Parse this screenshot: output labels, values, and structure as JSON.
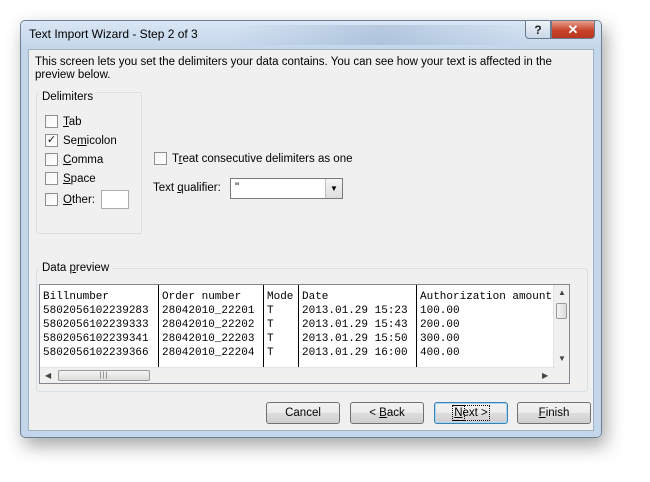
{
  "window": {
    "title": "Text Import Wizard - Step 2 of 3",
    "help_glyph": "?",
    "close_glyph": "✕"
  },
  "intro": "This screen lets you set the delimiters your data contains.  You can see how your text is affected in the preview below.",
  "delimiters": {
    "label": "Delimiters",
    "options": [
      {
        "label": "Tab",
        "checked": false,
        "mark": ""
      },
      {
        "label": "Semicolon",
        "checked": true,
        "mark": "✓"
      },
      {
        "label": "Comma",
        "checked": false,
        "mark": ""
      },
      {
        "label": "Space",
        "checked": false,
        "mark": ""
      },
      {
        "label": "Other:",
        "checked": false,
        "mark": ""
      }
    ],
    "other_value": ""
  },
  "treat_consecutive": {
    "label": "Treat consecutive delimiters as one",
    "checked": false
  },
  "text_qualifier": {
    "label": "Text qualifier:",
    "value": "\""
  },
  "data_preview": {
    "label": "Data preview",
    "columns": [
      "Billnumber",
      "Order number",
      "Mode",
      "Date",
      "Authorization amount"
    ],
    "rows": [
      [
        "5802056102239283",
        "28042010_22201",
        "T",
        "2013.01.29 15:23",
        "100.00"
      ],
      [
        "5802056102239333",
        "28042010_22202",
        "T",
        "2013.01.29 15:43",
        "200.00"
      ],
      [
        "5802056102239341",
        "28042010_22203",
        "T",
        "2013.01.29 15:50",
        "300.00"
      ],
      [
        "5802056102239366",
        "28042010_22204",
        "T",
        "2013.01.29 16:00",
        "400.00"
      ]
    ]
  },
  "buttons": {
    "cancel": "Cancel",
    "back": "< Back",
    "next": "Next >",
    "finish": "Finish"
  }
}
